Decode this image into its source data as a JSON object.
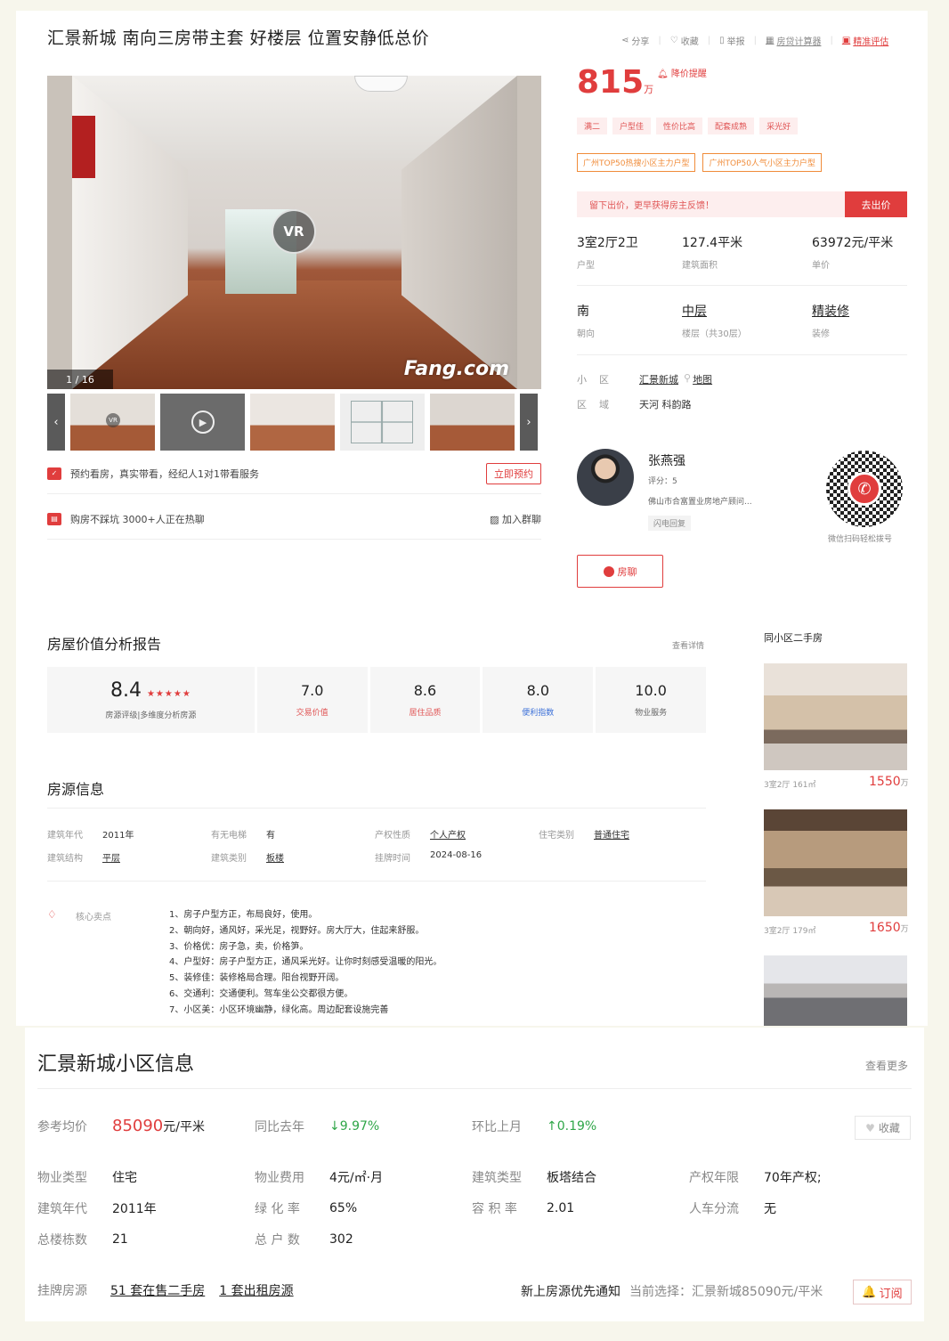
{
  "header": {
    "title": "汇景新城 南向三房带主套 好楼层 位置安静低总价",
    "actions": [
      "分享",
      "收藏",
      "举报",
      "房贷计算器",
      "精准评估"
    ]
  },
  "gallery": {
    "vr": "VR",
    "watermark": "Fang.com",
    "counter": "1 / 16",
    "thumb_vr": "VR",
    "play": "▶"
  },
  "services": {
    "booking": "预约看房，真实带看，经纪人1对1带看服务",
    "booking_btn": "立即预约",
    "group": "购房不踩坑 3000+人正在热聊",
    "group_btn": "加入群聊"
  },
  "price": {
    "value": "815",
    "unit": "万",
    "alert": "降价提醒"
  },
  "tags": [
    "满二",
    "户型佳",
    "性价比高",
    "配套成熟",
    "采光好"
  ],
  "rank_tags": [
    "广州TOP50热搜小区主力户型",
    "广州TOP50人气小区主力户型"
  ],
  "offer": {
    "text": "留下出价，更早获得房主反馈！",
    "button": "去出价"
  },
  "stats1": [
    {
      "value": "3室2厅2卫",
      "label": "户型"
    },
    {
      "value": "127.4平米",
      "label": "建筑面积"
    },
    {
      "value": "63972元/平米",
      "label": "单价"
    }
  ],
  "stats2": [
    {
      "value": "南",
      "label": "朝向"
    },
    {
      "value": "中层",
      "label": "楼层（共30层）"
    },
    {
      "value": "精装修",
      "label": "装修"
    }
  ],
  "location": {
    "community_key": "小区",
    "community": "汇景新城",
    "map": "地图",
    "area_key": "区域",
    "area": "天河  科韵路"
  },
  "agent": {
    "name": "张燕强",
    "score": "评分：5",
    "company": "佛山市合富置业房地产顾问...",
    "badge": "闪电回复",
    "qr_caption": "微信扫码轻松拨号",
    "chat": "房聊"
  },
  "report": {
    "title": "房屋价值分析报告",
    "more": "查看详情",
    "overall": {
      "value": "8.4",
      "stars": "★★★★★",
      "label": "房源评级|多维度分析房源"
    },
    "items": [
      {
        "value": "7.0",
        "label": "交易价值"
      },
      {
        "value": "8.6",
        "label": "居住品质"
      },
      {
        "value": "8.0",
        "label": "便利指数"
      },
      {
        "value": "10.0",
        "label": "物业服务"
      }
    ]
  },
  "source": {
    "title": "房源信息",
    "row1": [
      {
        "k": "建筑年代",
        "v": "2011年"
      },
      {
        "k": "有无电梯",
        "v": "有"
      },
      {
        "k": "产权性质",
        "v": "个人产权"
      },
      {
        "k": "住宅类别",
        "v": "普通住宅"
      }
    ],
    "row2": [
      {
        "k": "建筑结构",
        "v": "平层"
      },
      {
        "k": "建筑类别",
        "v": "板楼"
      },
      {
        "k": "挂牌时间",
        "v": "2024-08-16"
      }
    ],
    "core_key": "核心卖点",
    "core": [
      "1、房子户型方正，布局良好，使用。",
      "2、朝向好，通风好，采光足，视野好。房大厅大，住起来舒服。",
      "3、价格优：房子急，卖，价格笋。",
      "4、户型好：房子户型方正，通风采光好。让你时刻感受温暖的阳光。",
      "5、装修佳：装修格局合理。阳台视野开阔。",
      "6、交通利：交通便利。驾车坐公交都很方便。",
      "7、小区美：小区环境幽静，绿化高。周边配套设施完善"
    ]
  },
  "same_community": {
    "title": "同小区二手房",
    "items": [
      {
        "meta": "3室2厅   161㎡",
        "price": "1550",
        "unit": "万"
      },
      {
        "meta": "3室2厅   179㎡",
        "price": "1650",
        "unit": "万"
      }
    ]
  },
  "community_info": {
    "title": "汇景新城小区信息",
    "more": "查看更多",
    "avg_key": "参考均价",
    "avg_value": "85090",
    "avg_unit": "元/平米",
    "yoy_key": "同比去年",
    "yoy_value": "↓9.97%",
    "mom_key": "环比上月",
    "mom_value": "↑0.19%",
    "fav": "收藏",
    "fav_icon": "♥",
    "rows": [
      [
        {
          "k": "物业类型",
          "v": "住宅"
        },
        {
          "k": "物业费用",
          "v": "4元/㎡·月"
        },
        {
          "k": "建筑类型",
          "v": "板塔结合"
        },
        {
          "k": "产权年限",
          "v": "70年产权;"
        }
      ],
      [
        {
          "k": "建筑年代",
          "v": "2011年"
        },
        {
          "k": "绿 化 率",
          "v": "65%"
        },
        {
          "k": "容 积 率",
          "v": "2.01"
        },
        {
          "k": "人车分流",
          "v": "无"
        }
      ],
      [
        {
          "k": "总楼栋数",
          "v": "21"
        },
        {
          "k": "总 户 数",
          "v": "302"
        }
      ]
    ],
    "listing_key": "挂牌房源",
    "sale_link": "51 套在售二手房",
    "rent_link": "1 套出租房源",
    "notify": "新上房源优先通知",
    "current": "当前选择：汇景新城85090元/平米",
    "subscribe": "订阅",
    "subscribe_icon": "🔔"
  },
  "colors": {
    "accent": "#e03d3d",
    "green": "#2fa648",
    "orange": "#f08c3a",
    "blue": "#3a6fd8"
  }
}
